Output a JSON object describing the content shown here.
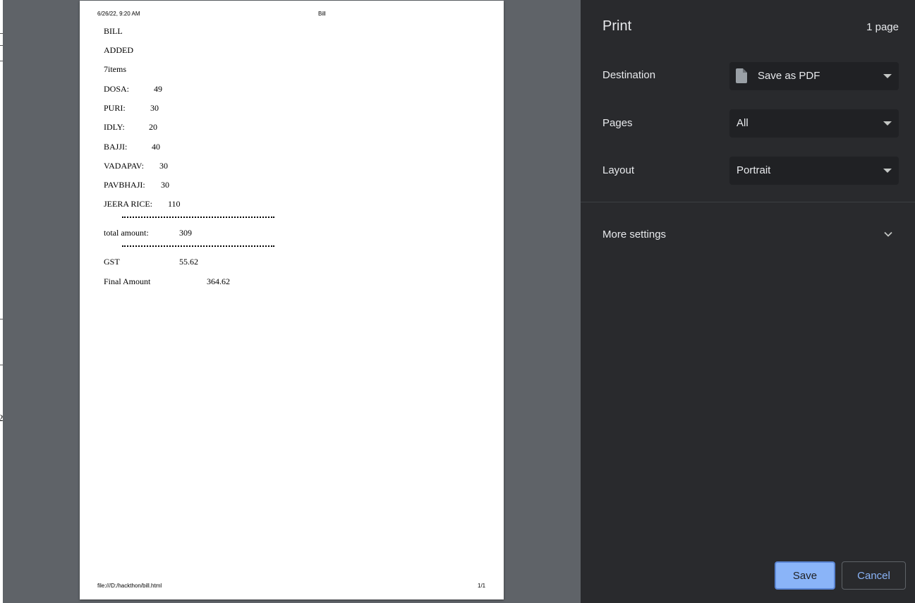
{
  "background_digits": [
    "2"
  ],
  "document": {
    "header_datetime": "6/26/22, 9:20 AM",
    "header_title": "Bill",
    "footer_url": "file:///D:/hackthon/bill.html",
    "footer_page": "1/1",
    "bill_heading": "BILL",
    "added_label": "ADDED",
    "item_count": "7items",
    "items": [
      {
        "name": "DOSA:",
        "price": "49"
      },
      {
        "name": "PURI:",
        "price": "30"
      },
      {
        "name": "IDLY:",
        "price": "20"
      },
      {
        "name": "BAJJI:",
        "price": "40"
      },
      {
        "name": "VADAPAV:",
        "price": "30"
      },
      {
        "name": "PAVBHAJI:",
        "price": "30"
      },
      {
        "name": "JEERA RICE:",
        "price": "110"
      }
    ],
    "total_label": "total amount:",
    "total_value": "309",
    "gst_label": "GST",
    "gst_value": "55.62",
    "final_label": "Final Amount",
    "final_value": "364.62"
  },
  "panel": {
    "title": "Print",
    "page_count": "1 page",
    "destination_label": "Destination",
    "destination_value": "Save as PDF",
    "pages_label": "Pages",
    "pages_value": "All",
    "layout_label": "Layout",
    "layout_value": "Portrait",
    "more_settings_label": "More settings",
    "save_label": "Save",
    "cancel_label": "Cancel"
  },
  "colors": {
    "panel_bg": "#292a2d",
    "select_bg": "#202124",
    "accent": "#8ab4f8",
    "preview_bg": "#5f6368"
  },
  "icons": [
    "document-icon",
    "dropdown-arrow-icon",
    "chevron-down-icon"
  ]
}
